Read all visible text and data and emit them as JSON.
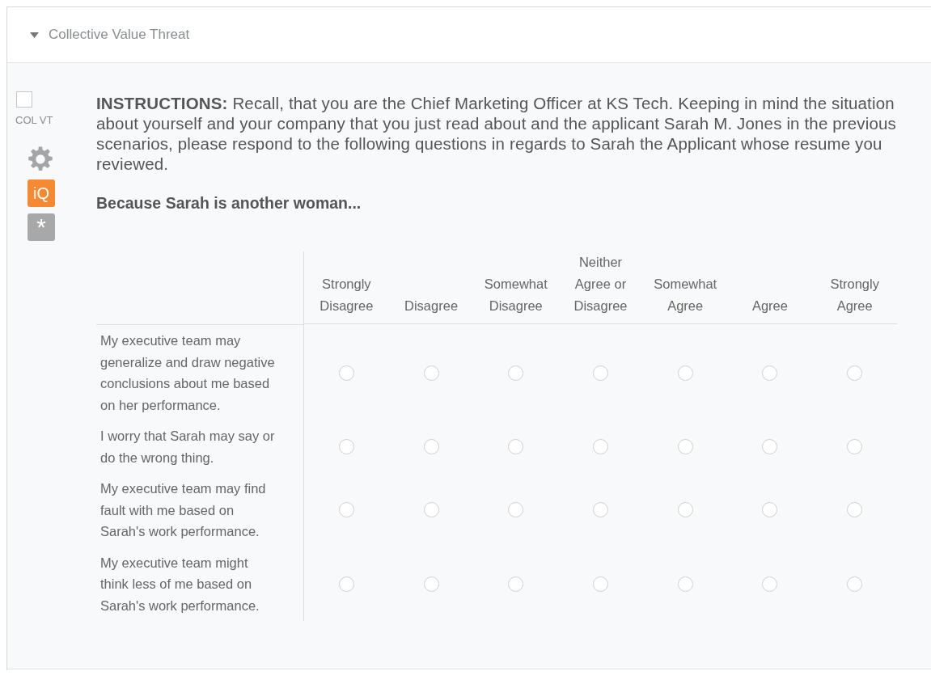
{
  "block": {
    "title": "Collective Value Threat",
    "expanded": true
  },
  "question": {
    "checked": false,
    "label": "COL VT",
    "instructions": "**INSTRUCTIONS:** Recall, that you are the Chief Marketing Officer at KS Tech. Keeping in mind the situation about yourself and your company that you just read about and the applicant Sarah M. Jones in the previous scenarios, please respond to the following questions in regards to Sarah the Applicant whose resume you reviewed.",
    "prompt": "Because Sarah is another woman...",
    "badges": [
      {
        "kind": "iq",
        "label": "iQ"
      },
      {
        "kind": "required",
        "label": "*"
      }
    ]
  },
  "matrix": {
    "columns": [
      "Strongly Disagree",
      "Disagree",
      "Somewhat Disagree",
      "Neither Agree or Disagree",
      "Somewhat Agree",
      "Agree",
      "Strongly Agree"
    ],
    "rows": [
      {
        "statement": "My executive team may generalize and draw negative conclusions about me based on her performance.",
        "choices": [
          {
            "selected": false
          },
          {
            "selected": false
          },
          {
            "selected": false
          },
          {
            "selected": false
          },
          {
            "selected": false
          },
          {
            "selected": false
          },
          {
            "selected": false
          }
        ]
      },
      {
        "statement": "I worry that Sarah may say or do the wrong thing.",
        "choices": [
          {
            "selected": false
          },
          {
            "selected": false
          },
          {
            "selected": false
          },
          {
            "selected": false
          },
          {
            "selected": false
          },
          {
            "selected": false
          },
          {
            "selected": false
          }
        ]
      },
      {
        "statement": "My executive team may find fault with me based on Sarah's work performance.",
        "choices": [
          {
            "selected": false
          },
          {
            "selected": false
          },
          {
            "selected": false
          },
          {
            "selected": false
          },
          {
            "selected": false
          },
          {
            "selected": false
          },
          {
            "selected": false
          }
        ]
      },
      {
        "statement": "My executive team might think less of me based on Sarah's work performance.",
        "choices": [
          {
            "selected": false
          },
          {
            "selected": false
          },
          {
            "selected": false
          },
          {
            "selected": false
          },
          {
            "selected": false
          },
          {
            "selected": false
          },
          {
            "selected": false
          }
        ]
      }
    ]
  }
}
